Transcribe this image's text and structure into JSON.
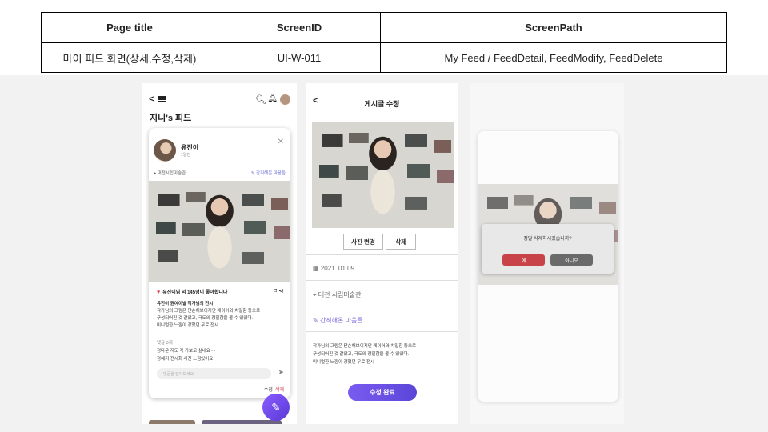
{
  "header": {
    "col1_title": "Page title",
    "col2_title": "ScreenID",
    "col3_title": "ScreenPath",
    "page_title": "마이 피드 화면(상세,수정,삭제)",
    "screen_id": "UI-W-011",
    "screen_path": "My Feed / FeedDetail, FeedModify, FeedDelete"
  },
  "feed": {
    "page_heading": "지니's 피드",
    "author": "유진이",
    "time": "1일전",
    "location": "대전시립미술관",
    "mood": "간직해온 마음들",
    "likes": "유진이님 외 145명이 좋아합니다",
    "body_line1": "유진이 원여이별 작가님의 전시",
    "body_line2": "작가님의 그림은 단순해보이지만 레이어와 치밀함 등으로",
    "body_line3": "구성되어진 것 같았고, 극도의 정밀함을 볼 수 있었다.",
    "body_line4": "미니멀한 느낌이 강했던 무료 전시",
    "comment_header": "댓글 3개",
    "comment1": "정다운 저도 꼭 가보고 싶네요~~",
    "comment2": "정혜지 전시회 사진 느낌있어요",
    "comment_placeholder": "댓글을 달아보세요",
    "edit_label": "수정",
    "delete_label": "삭제"
  },
  "edit": {
    "title": "게시글 수정",
    "change_photo": "사진 변경",
    "delete_photo": "삭제",
    "date": "2021. 01.09",
    "location": "대전 시립미술관",
    "mood": "간직해온 마음들",
    "body_line1": "작가님의 그림은 단순해보이지만 레이어와 치밀함 등으로",
    "body_line2": "구성되어진 것 같았고, 극도의 정밀함을 볼 수 있었다.",
    "body_line3": "미니멀한 느낌이 강했던 무료 전시",
    "done": "수정 완료"
  },
  "delete_dialog": {
    "question": "정말 삭제하시겠습니까?",
    "yes": "예",
    "no": "아니오"
  },
  "colors": {
    "accent": "#6b4fe0",
    "danger": "#c8424a",
    "like": "#e0394f"
  }
}
